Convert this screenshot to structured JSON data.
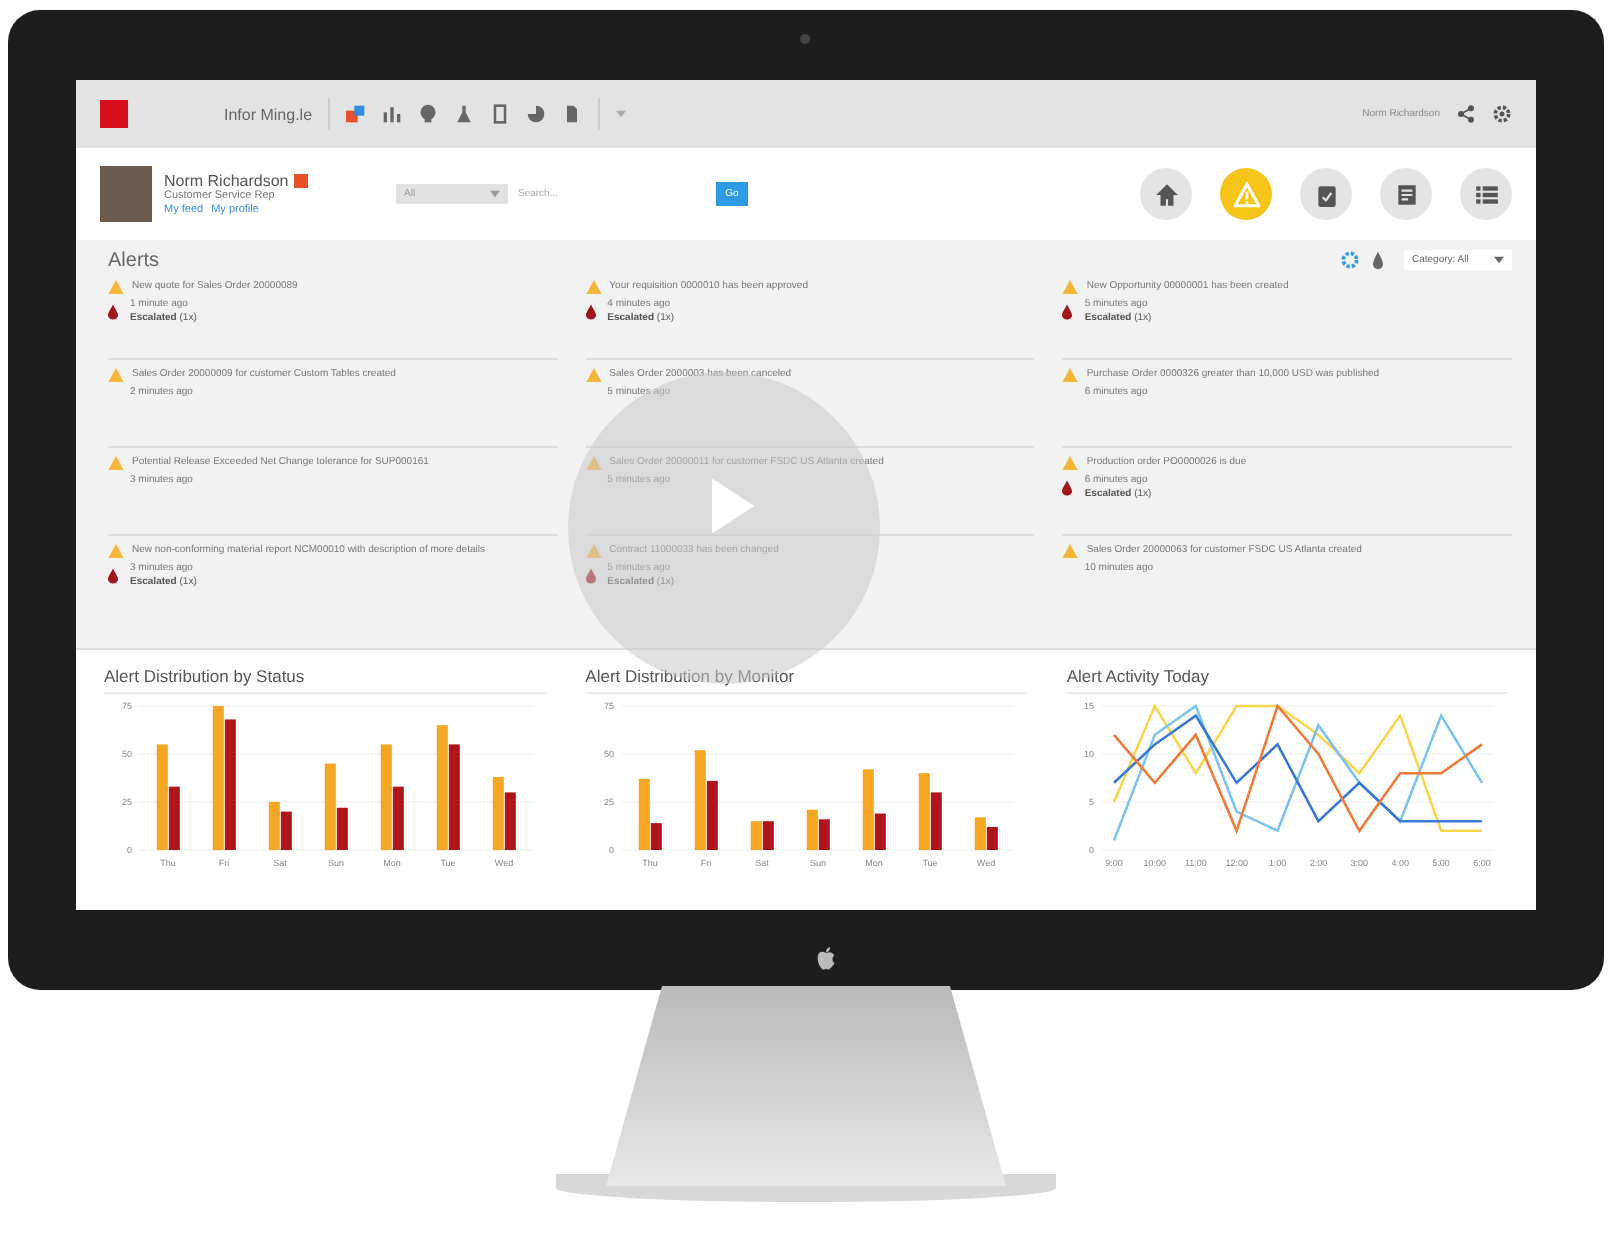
{
  "top_bar": {
    "app_title": "Infor Ming.le",
    "user_menu": "Norm Richardson"
  },
  "profile": {
    "name": "Norm Richardson",
    "role": "Customer Service Rep",
    "links": [
      "My feed",
      "My profile"
    ]
  },
  "search": {
    "scope": "All",
    "placeholder": "Search...",
    "button": "Go"
  },
  "nav": [
    {
      "selected": false
    },
    {
      "selected": true
    },
    {
      "selected": false
    },
    {
      "selected": false
    },
    {
      "selected": false
    }
  ],
  "alerts": {
    "title": "Alerts",
    "category": "Category: All",
    "columns": [
      {
        "items": [
          {
            "message": "New quote for Sales Order 20000089",
            "time": "1 minute ago",
            "escalation": "**Escalated** (1x)"
          },
          {
            "message": "Sales Order 20000009 for customer Custom Tables created",
            "time": "2 minutes ago"
          },
          {
            "message": "Potential Release Exceeded Net Change tolerance for SUP000161",
            "time": "3 minutes ago"
          },
          {
            "message": "New non-conforming material report NCM00010 with description of more details",
            "time": "3 minutes ago",
            "escalation": "**Escalated** (1x)"
          }
        ]
      },
      {
        "items": [
          {
            "message": "Your requisition 0000010 has been approved",
            "time": "4 minutes ago",
            "escalation": "**Escalated** (1x)"
          },
          {
            "message": "Sales Order 2000003 has been canceled",
            "time": "5 minutes ago"
          },
          {
            "message": "Sales Order 20000011 for customer FSDC US Atlanta created",
            "time": "5 minutes ago"
          },
          {
            "message": "Contract 11000033 has been changed",
            "time": "5 minutes ago",
            "escalation": "**Escalated** (1x)"
          }
        ]
      },
      {
        "items": [
          {
            "message": "New Opportunity 00000001 has been created",
            "time": "5 minutes ago",
            "escalation": "**Escalated** (1x)"
          },
          {
            "message": "Purchase Order 0000326 greater than 10,000 USD was published",
            "time": "6 minutes ago"
          },
          {
            "message": "Production order PO0000026 is due",
            "time": "6 minutes ago",
            "escalation": "**Escalated** (1x)"
          },
          {
            "message": "Sales Order 20000063 for customer FSDC US Atlanta created",
            "time": "10 minutes ago"
          }
        ]
      }
    ]
  },
  "charts": [
    {
      "chart_data": {
        "type": "bar",
        "title": "Alert Distribution by Status",
        "categories": [
          "Thu",
          "Fri",
          "Sat",
          "Sun",
          "Mon",
          "Tue",
          "Wed"
        ],
        "grid": true,
        "ylim": [
          0,
          75
        ],
        "yticks": [
          0,
          25,
          50,
          75
        ],
        "series": [
          {
            "color": "#f5a623",
            "values": [
              55,
              75,
              25,
              45,
              55,
              65,
              38
            ]
          },
          {
            "color": "#b0151b",
            "values": [
              33,
              68,
              20,
              22,
              33,
              55,
              30
            ]
          }
        ]
      }
    },
    {
      "chart_data": {
        "type": "bar",
        "title": "Alert Distribution by Monitor",
        "categories": [
          "Thu",
          "Fri",
          "Sat",
          "Sun",
          "Mon",
          "Tue",
          "Wed"
        ],
        "grid": true,
        "ylim": [
          0,
          75
        ],
        "yticks": [
          0,
          25,
          50,
          75
        ],
        "series": [
          {
            "color": "#f5a623",
            "values": [
              37,
              52,
              15,
              21,
              42,
              40,
              17
            ]
          },
          {
            "color": "#b0151b",
            "values": [
              14,
              36,
              15,
              16,
              19,
              30,
              12
            ]
          }
        ]
      }
    },
    {
      "chart_data": {
        "type": "line",
        "title": "Alert Activity Today",
        "categories": [
          "9:00",
          "10:00",
          "11:00",
          "12:00",
          "1:00",
          "2:00",
          "3:00",
          "4:00",
          "5:00",
          "6:00"
        ],
        "grid": true,
        "ylim": [
          0,
          15
        ],
        "yticks": [
          0,
          5,
          10,
          15
        ],
        "series": [
          {
            "color": "#f8d64e",
            "values": [
              5,
              15,
              8,
              15,
              15,
              12,
              8,
              14,
              2,
              2
            ]
          },
          {
            "color": "#7cc4f0",
            "values": [
              1,
              12,
              15,
              4,
              2,
              13,
              7,
              3,
              14,
              7
            ]
          },
          {
            "color": "#3a78d4",
            "values": [
              7,
              11,
              14,
              7,
              11,
              3,
              7,
              3,
              3,
              3
            ]
          },
          {
            "color": "#f07a3a",
            "values": [
              12,
              7,
              12,
              2,
              15,
              10,
              2,
              8,
              8,
              11
            ]
          }
        ]
      }
    }
  ]
}
